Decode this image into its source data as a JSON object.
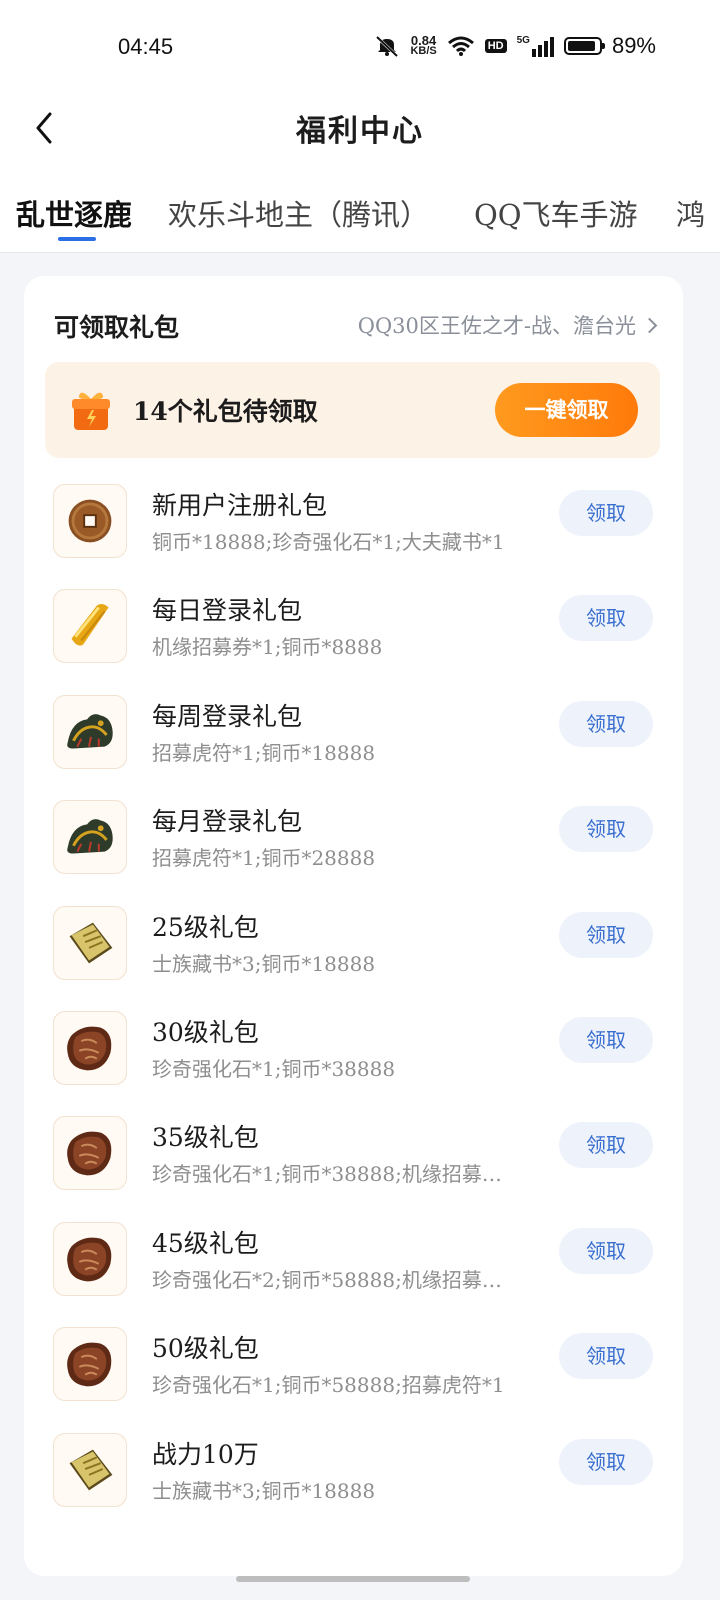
{
  "status_bar": {
    "time": "04:45",
    "net_speed": "0.84",
    "net_unit": "KB/S",
    "hd": "HD",
    "signal": "5G",
    "battery_level": 0.89,
    "battery_text": "89%"
  },
  "header": {
    "title": "福利中心"
  },
  "tabs": [
    {
      "label": "乱世逐鹿",
      "active": true
    },
    {
      "label": "欢乐斗地主（腾讯）",
      "active": false
    },
    {
      "label": "QQ飞车手游",
      "active": false
    },
    {
      "label": "鸿",
      "active": false
    }
  ],
  "accent_color": "#2b6fe6",
  "card": {
    "title": "可领取礼包",
    "server": "QQ30区王佐之才-战、澹台光",
    "banner_text": "14个礼包待领取",
    "claim_all_label": "一键领取"
  },
  "gifts": [
    {
      "name": "新用户注册礼包",
      "desc": "铜币*18888;珍奇强化石*1;大夫藏书*1",
      "icon": "coin-icon",
      "button": "领取"
    },
    {
      "name": "每日登录礼包",
      "desc": "机缘招募券*1;铜币*8888",
      "icon": "ticket-icon",
      "button": "领取"
    },
    {
      "name": "每周登录礼包",
      "desc": "招募虎符*1;铜币*18888",
      "icon": "tiger-tally-icon",
      "button": "领取"
    },
    {
      "name": "每月登录礼包",
      "desc": "招募虎符*1;铜币*28888",
      "icon": "tiger-tally-icon",
      "button": "领取"
    },
    {
      "name": "25级礼包",
      "desc": "士族藏书*3;铜币*18888",
      "icon": "book-icon",
      "button": "领取"
    },
    {
      "name": "30级礼包",
      "desc": "珍奇强化石*1;铜币*38888",
      "icon": "stone-icon",
      "button": "领取"
    },
    {
      "name": "35级礼包",
      "desc": "珍奇强化石*1;铜币*38888;机缘招募…",
      "icon": "stone-icon",
      "button": "领取"
    },
    {
      "name": "45级礼包",
      "desc": "珍奇强化石*2;铜币*58888;机缘招募…",
      "icon": "stone-icon",
      "button": "领取"
    },
    {
      "name": "50级礼包",
      "desc": "珍奇强化石*1;铜币*58888;招募虎符*1",
      "icon": "stone-icon",
      "button": "领取"
    },
    {
      "name": "战力10万",
      "desc": "士族藏书*3;铜币*18888",
      "icon": "book-icon",
      "button": "领取"
    }
  ]
}
